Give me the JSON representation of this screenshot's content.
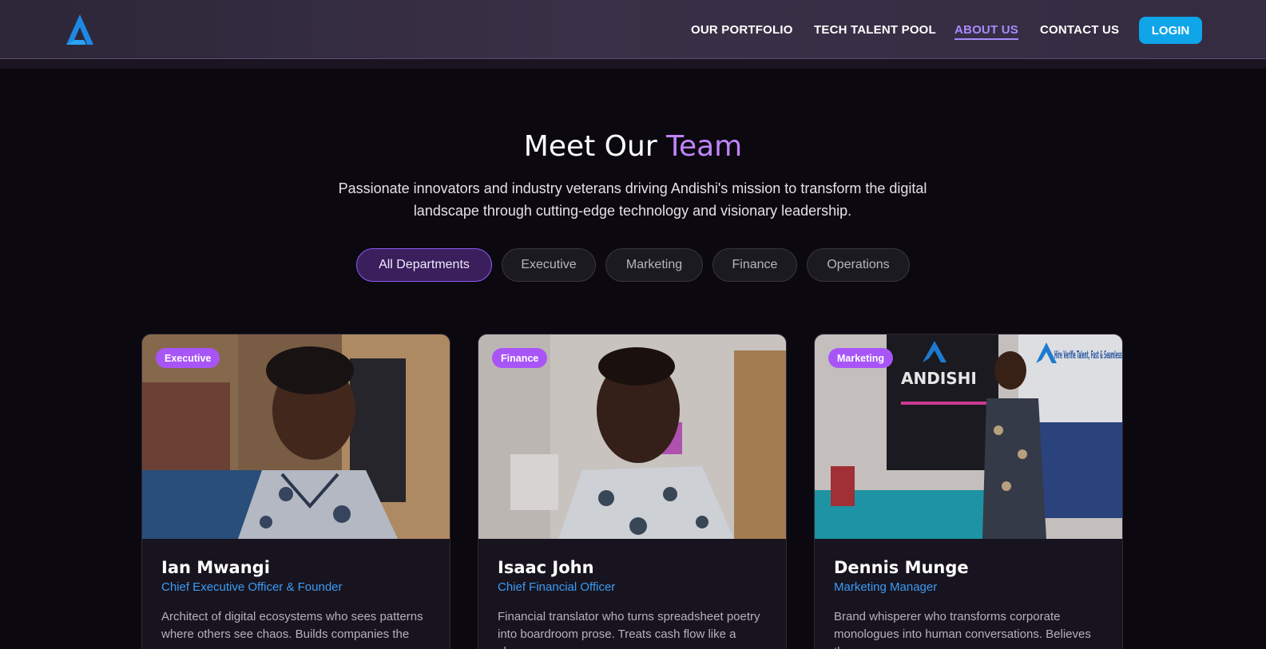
{
  "nav": {
    "links": [
      "OUR PORTFOLIO",
      "TECH TALENT POOL",
      "ABOUT US",
      "CONTACT US"
    ],
    "active": "ABOUT US",
    "login_label": "LOGIN"
  },
  "hero": {
    "title_main": "Meet Our ",
    "title_accent": "Team",
    "subtitle": "Passionate innovators and industry veterans driving Andishi's mission to transform the digital landscape through cutting-edge technology and visionary leadership."
  },
  "filters": [
    "All Departments",
    "Executive",
    "Marketing",
    "Finance",
    "Operations"
  ],
  "team": [
    {
      "department": "Executive",
      "name": "Ian Mwangi",
      "role": "Chief Executive Officer & Founder",
      "bio": "Architect of digital ecosystems who sees patterns where others see chaos. Builds companies the way"
    },
    {
      "department": "Finance",
      "name": "Isaac John",
      "role": "Chief Financial Officer",
      "bio": "Financial translator who turns spreadsheet poetry into boardroom prose. Treats cash flow like a chess"
    },
    {
      "department": "Marketing",
      "name": "Dennis Munge",
      "role": "Marketing Manager",
      "bio": "Brand whisperer who transforms corporate monologues into human conversations. Believes the"
    }
  ],
  "photo3": {
    "banner_left": "ANDISHI",
    "banner_right": "Hire Verifie Talent, Fast & Seamlessl"
  },
  "colors": {
    "accent_purple": "#c084fc",
    "badge_purple": "#a855f7",
    "role_blue": "#3b9cf5",
    "login_blue": "#0ea5e9",
    "logo_blue": "#1e88e5"
  }
}
